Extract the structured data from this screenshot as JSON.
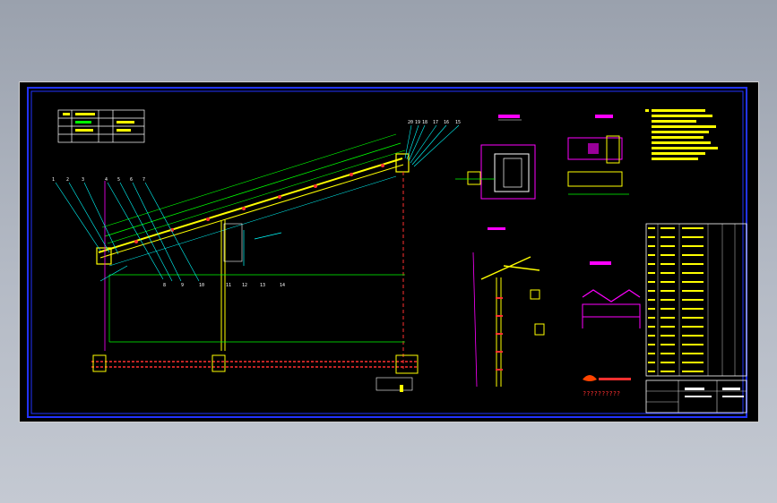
{
  "drawing": {
    "company_note": "??????????",
    "colors": {
      "background": "#000000",
      "frame": "#2222ff",
      "yellow": "#ffff00",
      "green": "#00ff00",
      "cyan": "#00ffff",
      "magenta": "#ff00ff",
      "red": "#ff3030",
      "white": "#ffffff"
    },
    "balloons_top": [
      "20",
      "19",
      "18",
      "17",
      "16",
      "15"
    ],
    "balloons_left": [
      "1",
      "2",
      "3",
      "4",
      "5",
      "6",
      "7",
      "8",
      "9"
    ],
    "balloons_bottom": [
      "10",
      "11",
      "12",
      "13",
      "14"
    ]
  }
}
